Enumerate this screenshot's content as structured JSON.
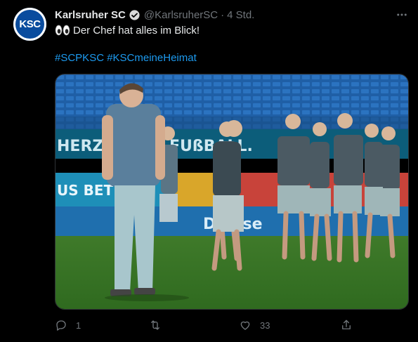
{
  "tweet": {
    "avatar_text": "KSC",
    "display_name": "Karlsruher SC",
    "handle": "@KarlsruherSC",
    "separator": "·",
    "time": "4 Std.",
    "text": "Der Chef hat alles im Blick!",
    "hashtags": [
      "#SCPKSC",
      "#KSCmeineHeimat"
    ],
    "media": {
      "banner_text_1": "HERZ",
      "banner_text_2": "FUßBALL.",
      "board_text_1": "US BET",
      "board_text_2": "Den se"
    },
    "actions": {
      "reply_count": "1",
      "retweet_count": "",
      "like_count": "33"
    }
  },
  "colors": {
    "background": "#000000",
    "text": "#e7e9ea",
    "muted": "#71767b",
    "link": "#1d9bf0",
    "brand_blue": "#0a4c9e"
  },
  "icons": [
    "verified-icon",
    "more-icon",
    "eyes-emoji-icon",
    "reply-icon",
    "retweet-icon",
    "like-icon",
    "share-icon"
  ]
}
